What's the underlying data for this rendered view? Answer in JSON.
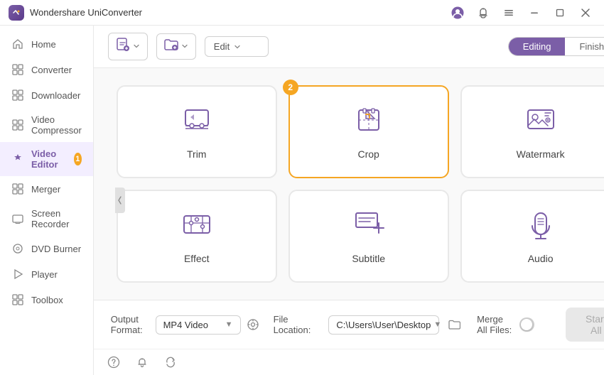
{
  "titleBar": {
    "appName": "Wondershare UniConverter",
    "controls": [
      "user-icon",
      "notification-icon",
      "menu-icon",
      "minimize-icon",
      "maximize-icon",
      "close-icon"
    ]
  },
  "sidebar": {
    "items": [
      {
        "id": "home",
        "label": "Home",
        "icon": "🏠",
        "active": false
      },
      {
        "id": "converter",
        "label": "Converter",
        "icon": "⊞",
        "active": false
      },
      {
        "id": "downloader",
        "label": "Downloader",
        "icon": "⊞",
        "active": false
      },
      {
        "id": "video-compressor",
        "label": "Video Compressor",
        "icon": "⊞",
        "active": false
      },
      {
        "id": "video-editor",
        "label": "Video Editor",
        "icon": "✦",
        "active": true,
        "badge": "1"
      },
      {
        "id": "merger",
        "label": "Merger",
        "icon": "⊞",
        "active": false
      },
      {
        "id": "screen-recorder",
        "label": "Screen Recorder",
        "icon": "⊞",
        "active": false
      },
      {
        "id": "dvd-burner",
        "label": "DVD Burner",
        "icon": "💿",
        "active": false
      },
      {
        "id": "player",
        "label": "Player",
        "icon": "▶",
        "active": false
      },
      {
        "id": "toolbox",
        "label": "Toolbox",
        "icon": "⊞",
        "active": false
      }
    ]
  },
  "toolbar": {
    "addFileLabel": "",
    "addFileIcon": "add-file-icon",
    "addFolderLabel": "",
    "addFolderIcon": "add-folder-icon",
    "editLabel": "Edit",
    "editIcon": "chevron-down-icon",
    "tabs": [
      {
        "label": "Editing",
        "active": true
      },
      {
        "label": "Finished",
        "active": false
      }
    ],
    "collapseIcon": "◀"
  },
  "editorCards": [
    {
      "id": "trim",
      "label": "Trim",
      "icon": "trim",
      "selected": false
    },
    {
      "id": "crop",
      "label": "Crop",
      "icon": "crop",
      "selected": true,
      "badge": "2"
    },
    {
      "id": "watermark",
      "label": "Watermark",
      "icon": "watermark",
      "selected": false
    },
    {
      "id": "effect",
      "label": "Effect",
      "icon": "effect",
      "selected": false
    },
    {
      "id": "subtitle",
      "label": "Subtitle",
      "icon": "subtitle",
      "selected": false
    },
    {
      "id": "audio",
      "label": "Audio",
      "icon": "audio",
      "selected": false
    }
  ],
  "bottomBar": {
    "outputFormatLabel": "Output Format:",
    "outputFormatValue": "MP4 Video",
    "settingsIcon": "settings-icon",
    "fileLocationLabel": "File Location:",
    "fileLocationValue": "C:\\Users\\User\\Desktop",
    "folderIcon": "folder-icon",
    "mergeAllLabel": "Merge All Files:",
    "startAllLabel": "Start All"
  },
  "statusBar": {
    "helpIcon": "help-icon",
    "notificationIcon": "bell-icon",
    "refreshIcon": "refresh-icon"
  },
  "colors": {
    "accent": "#7b5ea7",
    "orange": "#f5a623",
    "border": "#e8e8e8",
    "activeTab": "#7b5ea7"
  }
}
